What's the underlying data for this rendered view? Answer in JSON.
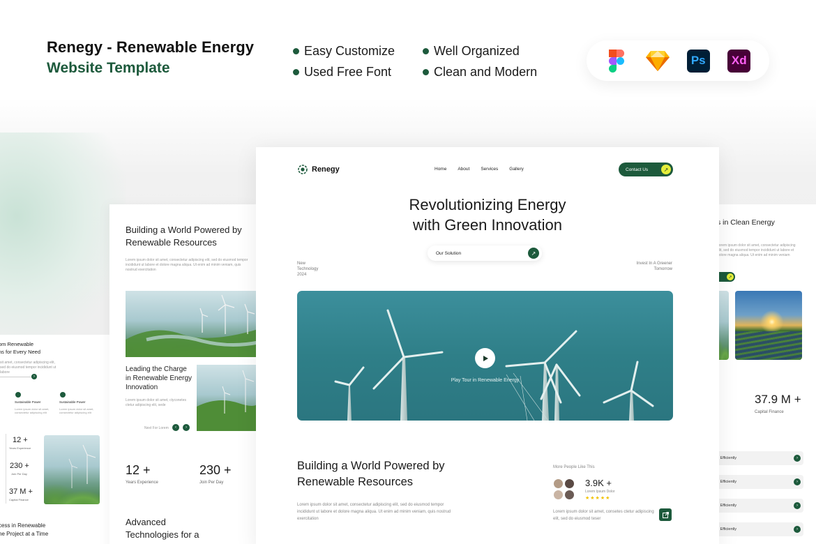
{
  "header": {
    "title_line1": "Renegy - Renewable Energy",
    "title_line2": "Website Template",
    "features": [
      "Easy Customize",
      "Well Organized",
      "Used Free Font",
      "Clean and Modern"
    ],
    "tools": [
      "figma-icon",
      "sketch-icon",
      "photoshop-icon",
      "xd-icon"
    ],
    "ps_label": "Ps",
    "xd_label": "Xd"
  },
  "colors": {
    "accent": "#1d5a3c",
    "highlight": "#e4ee3a",
    "stars": "#f2c200"
  },
  "main": {
    "brand": "Renegy",
    "nav": [
      "Home",
      "About",
      "Services",
      "Gallery"
    ],
    "contact_label": "Contact Us",
    "hero_line1": "Revolutionizing Energy",
    "hero_line2": "with Green Innovation",
    "solution_label": "Our Solution",
    "left_note": [
      "New",
      "Technology",
      "2024"
    ],
    "right_note": [
      "Invest In A Greener",
      "Tomorrow"
    ],
    "play_label": "Play Tour in Renewable Energy",
    "section_line1": "Building a World Powered by",
    "section_line2": "Renewable Resources",
    "section_body": "Lorem ipsum dolor sit amet, consectetur adipiscing elit, sed do eiusmod tempor incididunt ut labore et dolore magna aliqua. Ut enim ad minim veniam, quis nostrud exercitation",
    "more_people": "More People Like This",
    "count": "3.9K +",
    "count_sub": "Lorem Ipsum Dolor",
    "stars": "★★★★★",
    "right_body": "Lorem ipsum dolor sit amet, consetes ctetur adipiscing elit, sed do eiusmod teser"
  },
  "left_card": {
    "title_line1": "Building a World Powered by",
    "title_line2": "Renewable Resources",
    "body": "Lorem ipsum dolor sit amet, consectetur adipiscing elit, sed do eiusmod tempor incididunt ut labore et dolore magna aliqua. Ut enim ad minim veniam, quis nostrud exercitation",
    "leading_line1": "Leading the Charge",
    "leading_line2": "in Renewable Energy",
    "leading_line3": "Innovation",
    "leading_body": "Lorem ipsum dolor sit amet, ctyconetes ctetur adipiscing elit, sede",
    "next_label": "Next For Lorem",
    "stat1_num": "12 +",
    "stat1_lbl": "Years Experience",
    "stat2_num": "230 +",
    "stat2_lbl": "Join Per Day",
    "adv_line1": "Advanced",
    "adv_line2": "Technologies for a"
  },
  "far_left_card": {
    "title_line1": "om Renewable",
    "title_line2": "ns for Every Need",
    "body": "sit amet, consectetur adipiscing elit, sed do eiusmod tempor incididunt ut labore",
    "feature1": "Sustainable Power",
    "feature2": "Sustainable Power",
    "feature_body": "Lorem ipsum dolor sit amet, consectetur adipiscing elit",
    "s1_num": "12 +",
    "s1_lbl": "Years Experience",
    "s2_num": "230 +",
    "s2_lbl": "Join Per Day",
    "s3_num": "37 M +",
    "s3_lbl": "Capital Finance",
    "bottom_line1": "cess in Renewable",
    "bottom_line2": "he Project at a Time"
  },
  "right_card": {
    "title": "s in Clean Energy",
    "body": "Lorem ipsum dolor sit amet, consectetur adipiscing elit, sed do eiusmod tempor incididunt ut labore et dolore magna aliqua. Ut enim ad minim veniam",
    "stat_num": "37.9 M +",
    "stat_lbl": "Capital Finance",
    "rows": [
      "d Efficiently",
      "d Efficiently",
      "d Efficiently",
      "d Efficiently"
    ]
  }
}
